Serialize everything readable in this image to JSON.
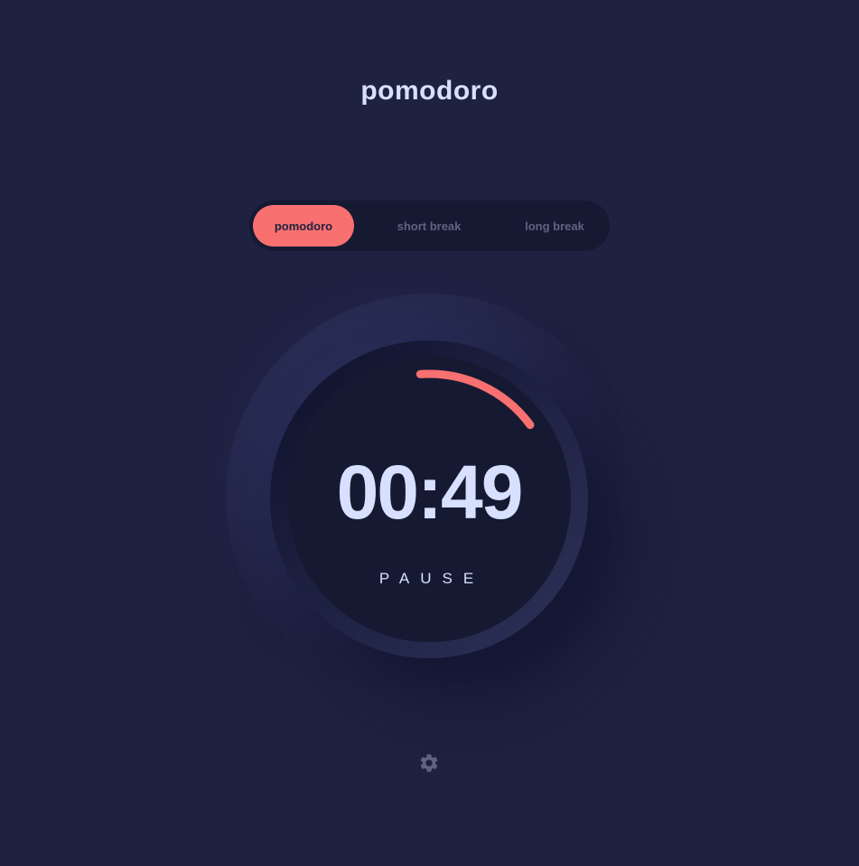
{
  "app": {
    "title": "pomodoro"
  },
  "modes": {
    "tabs": [
      {
        "label": "pomodoro",
        "active": true
      },
      {
        "label": "short break",
        "active": false
      },
      {
        "label": "long break",
        "active": false
      }
    ]
  },
  "timer": {
    "time": "00:49",
    "action_label": "PAUSE",
    "progress_fraction": 0.16
  },
  "settings": {
    "icon": "gear-icon"
  },
  "colors": {
    "background": "#1f2141",
    "panel": "#161932",
    "accent": "#f87070",
    "text": "#d7e0fe",
    "muted": "#5f6383"
  }
}
